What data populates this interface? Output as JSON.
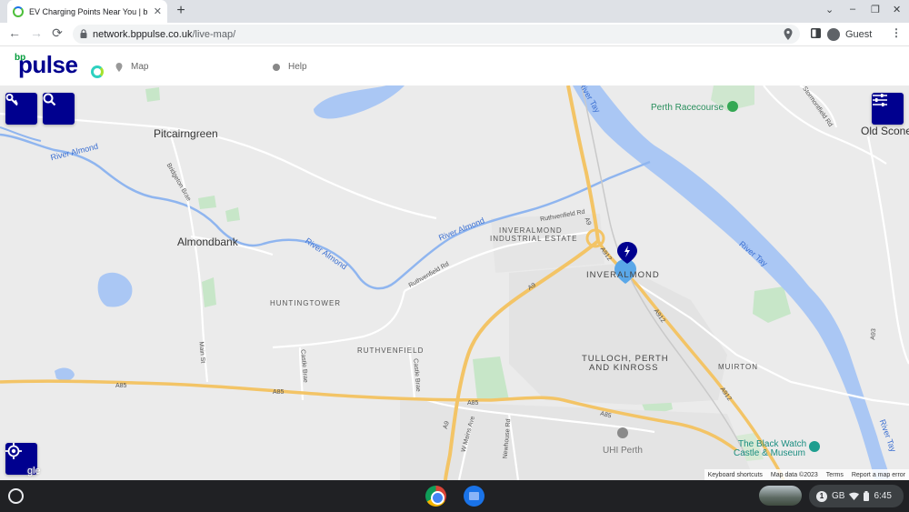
{
  "browser": {
    "tab_title": "EV Charging Points Near You | b",
    "tab_close": "✕",
    "new_tab": "+",
    "url_host": "network.bppulse.co.uk",
    "url_path": "/live-map/",
    "profile": "Guest",
    "window_controls": [
      "⌄",
      "–",
      "❐",
      "✕"
    ]
  },
  "site": {
    "logo_bp": "bp",
    "logo_pulse": "pulse",
    "nav": [
      {
        "label": "Map",
        "icon": "map-pin-icon"
      },
      {
        "label": "Help",
        "icon": "info-icon"
      }
    ]
  },
  "map": {
    "labels": {
      "pitcairngreen": "Pitcairngreen",
      "almondbank": "Almondbank",
      "old_scone": "Old Scone",
      "perth_racecourse": "Perth Racecourse",
      "inveralmond_estate_1": "INVERALMOND",
      "inveralmond_estate_2": "INDUSTRIAL ESTATE",
      "inveralmond": "INVERALMOND",
      "huntingtower": "HUNTINGTOWER",
      "ruthvenfield": "RUTHVENFIELD",
      "tulloch_1": "TULLOCH, PERTH",
      "tulloch_2": "AND KINROSS",
      "muirton": "MUIRTON",
      "uhi_perth": "UHI Perth",
      "black_watch_1": "The Black Watch",
      "black_watch_2": "Castle & Museum",
      "river_almond_1": "River Almond",
      "river_almond_2": "River Almond",
      "river_almond_3": "River Almond",
      "river_tay_1": "River Tay",
      "river_tay_2": "River Tay",
      "river_tay_3": "River Tay",
      "ruthvenfield_rd_1": "Ruthvenfield Rd",
      "ruthvenfield_rd_2": "Ruthvenfield Rd",
      "a85_1": "A85",
      "a85_2": "A85",
      "a85_3": "A85",
      "a85_4": "A85",
      "a9_1": "A9",
      "a9_2": "A9",
      "a9_3": "A9",
      "a912_1": "A912",
      "a912_2": "A912",
      "a912_3": "A912",
      "a93": "A93",
      "main_st": "Main St",
      "castle_brae": "Castle Brae",
      "castle_brae_2": "Castle Brae",
      "bridgeton_brae": "Bridgeton Brae",
      "w_mains_ave": "W Mains Ave",
      "newhouse_rd": "Newhouse Rd",
      "stormontfield_rd": "Stormontfield Rd"
    },
    "footer": [
      "Keyboard shortcuts",
      "Map data ©2023",
      "Terms",
      "Report a map error"
    ],
    "google_mark": "gle"
  },
  "shelf": {
    "tray_badge": "1",
    "tray_network": "GB",
    "time": "6:45"
  },
  "colors": {
    "brand_blue": "#00008f",
    "water": "#aac7f4",
    "highway": "#f6c05b",
    "park": "#c8e6c9"
  }
}
